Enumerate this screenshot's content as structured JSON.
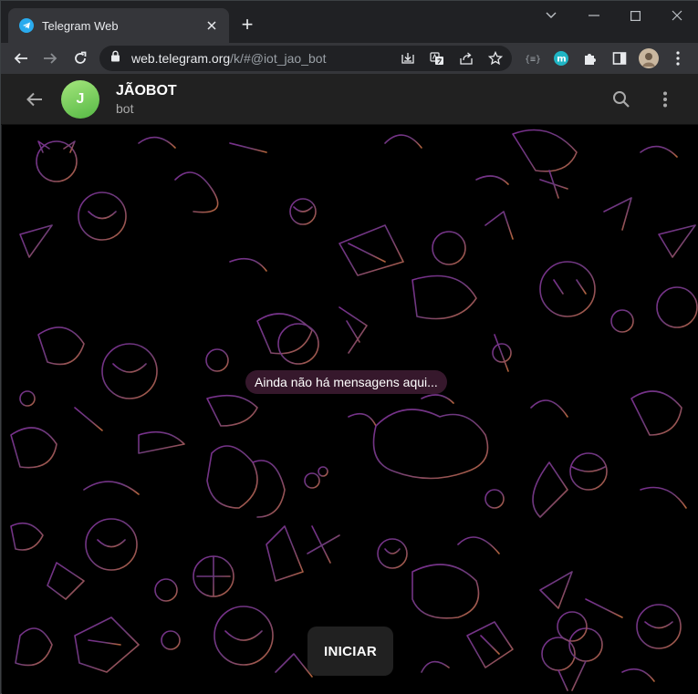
{
  "browser": {
    "tab": {
      "title": "Telegram Web",
      "favicon": "telegram-icon"
    },
    "new_tab": "+",
    "address": {
      "host": "web.telegram.org",
      "path": "/k/#@iot_jao_bot"
    }
  },
  "chat_header": {
    "avatar_letter": "J",
    "name": "JÃOBOT",
    "status": "bot"
  },
  "chat": {
    "empty_message": "Ainda não há mensagens aqui...",
    "start_button": "INICIAR"
  },
  "colors": {
    "avatar_gradient_top": "#a4e67c",
    "avatar_gradient_bottom": "#56b845",
    "pattern_purple": "#7a2f8f",
    "pattern_orange": "#b5653a",
    "telegram_blue": "#2aabee"
  }
}
